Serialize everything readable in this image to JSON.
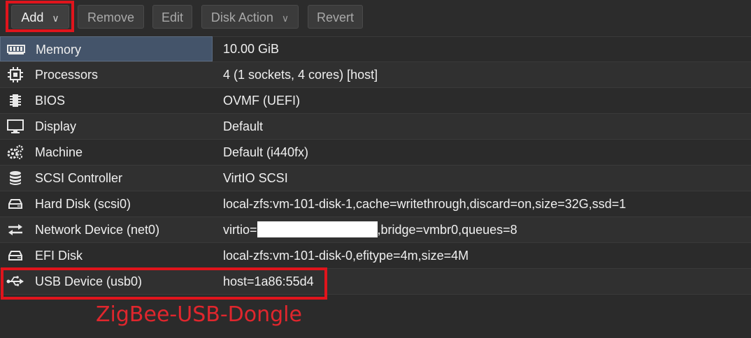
{
  "toolbar": {
    "add_label": "Add",
    "remove_label": "Remove",
    "edit_label": "Edit",
    "disk_action_label": "Disk Action",
    "revert_label": "Revert"
  },
  "hardware": [
    {
      "icon": "memory-icon",
      "name": "Memory",
      "value": "10.00 GiB"
    },
    {
      "icon": "cpu-icon",
      "name": "Processors",
      "value": "4 (1 sockets, 4 cores) [host]"
    },
    {
      "icon": "chip-icon",
      "name": "BIOS",
      "value": "OVMF (UEFI)"
    },
    {
      "icon": "monitor-icon",
      "name": "Display",
      "value": "Default"
    },
    {
      "icon": "gears-icon",
      "name": "Machine",
      "value": "Default (i440fx)"
    },
    {
      "icon": "database-icon",
      "name": "SCSI Controller",
      "value": "VirtIO SCSI"
    },
    {
      "icon": "hdd-icon",
      "name": "Hard Disk (scsi0)",
      "value": "local-zfs:vm-101-disk-1,cache=writethrough,discard=on,size=32G,ssd=1"
    },
    {
      "icon": "network-icon",
      "name": "Network Device (net0)",
      "value_prefix": "virtio=",
      "value_suffix": ",bridge=vmbr0,queues=8"
    },
    {
      "icon": "hdd-icon",
      "name": "EFI Disk",
      "value": "local-zfs:vm-101-disk-0,efitype=4m,size=4M"
    },
    {
      "icon": "usb-icon",
      "name": "USB Device (usb0)",
      "value": "host=1a86:55d4"
    }
  ],
  "annotation": "ZigBee-USB-Dongle",
  "colors": {
    "highlight": "#e0141c",
    "selected_row": "#44546a",
    "background": "#2b2b2b"
  }
}
